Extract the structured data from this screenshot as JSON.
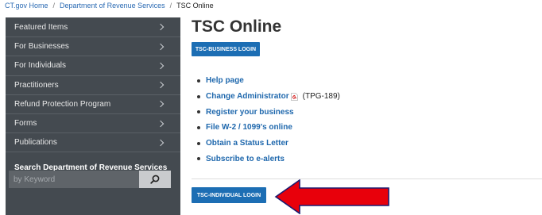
{
  "breadcrumb": {
    "home": "CT.gov Home",
    "separator": "/",
    "department": "Department of Revenue Services",
    "current": "TSC Online"
  },
  "sidebar": {
    "items": [
      {
        "label": "Featured Items"
      },
      {
        "label": "For Businesses"
      },
      {
        "label": "For Individuals"
      },
      {
        "label": "Practitioners"
      },
      {
        "label": "Refund Protection Program"
      },
      {
        "label": "Forms"
      },
      {
        "label": "Publications"
      }
    ],
    "search_heading": "Search Department of Revenue Services",
    "search_placeholder": "by Keyword",
    "search_icon": "search-icon"
  },
  "main": {
    "title": "TSC Online",
    "business_login": "TSC-BUSINESS LOGIN",
    "links": [
      {
        "label": "Help page"
      },
      {
        "label": "Change Administrator",
        "icon": "pdf-icon",
        "note": "(TPG-189)"
      },
      {
        "label": "Register your business"
      },
      {
        "label": "File W-2 / 1099's online"
      },
      {
        "label": "Obtain a Status Letter"
      },
      {
        "label": "Subscribe to e-alerts"
      }
    ],
    "individual_login": "TSC-INDIVIDUAL LOGIN"
  },
  "colors": {
    "sidebar_bg": "#444a50",
    "button_blue": "#1c6eb4",
    "link_blue": "#1f68ad",
    "arrow_red": "#e8000b"
  }
}
